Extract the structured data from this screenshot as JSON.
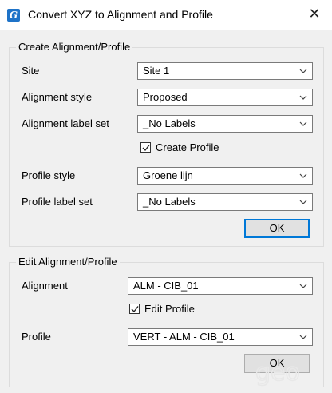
{
  "window": {
    "title": "Convert XYZ to Alignment and Profile",
    "close_glyph": "✕",
    "app_icon_glyph": "G"
  },
  "create_group": {
    "legend": "Create Alignment/Profile",
    "site_label": "Site",
    "site_value": "Site 1",
    "alignment_style_label": "Alignment style",
    "alignment_style_value": "Proposed",
    "alignment_label_set_label": "Alignment label set",
    "alignment_label_set_value": "_No Labels",
    "create_profile_label": "Create Profile",
    "create_profile_checked": true,
    "profile_style_label": "Profile style",
    "profile_style_value": "Groene lijn",
    "profile_label_set_label": "Profile label set",
    "profile_label_set_value": "_No Labels",
    "ok_label": "OK"
  },
  "edit_group": {
    "legend": "Edit Alignment/Profile",
    "alignment_label": "Alignment",
    "alignment_value": "ALM - CIB_01",
    "edit_profile_label": "Edit Profile",
    "edit_profile_checked": true,
    "profile_label": "Profile",
    "profile_value": "VERT - ALM - CIB_01",
    "ok_label": "OK"
  },
  "watermark": {
    "text": "geo"
  },
  "colors": {
    "accent": "#0078d7",
    "client_bg": "#f0f0f0",
    "button_bg": "#e1e1e1"
  }
}
